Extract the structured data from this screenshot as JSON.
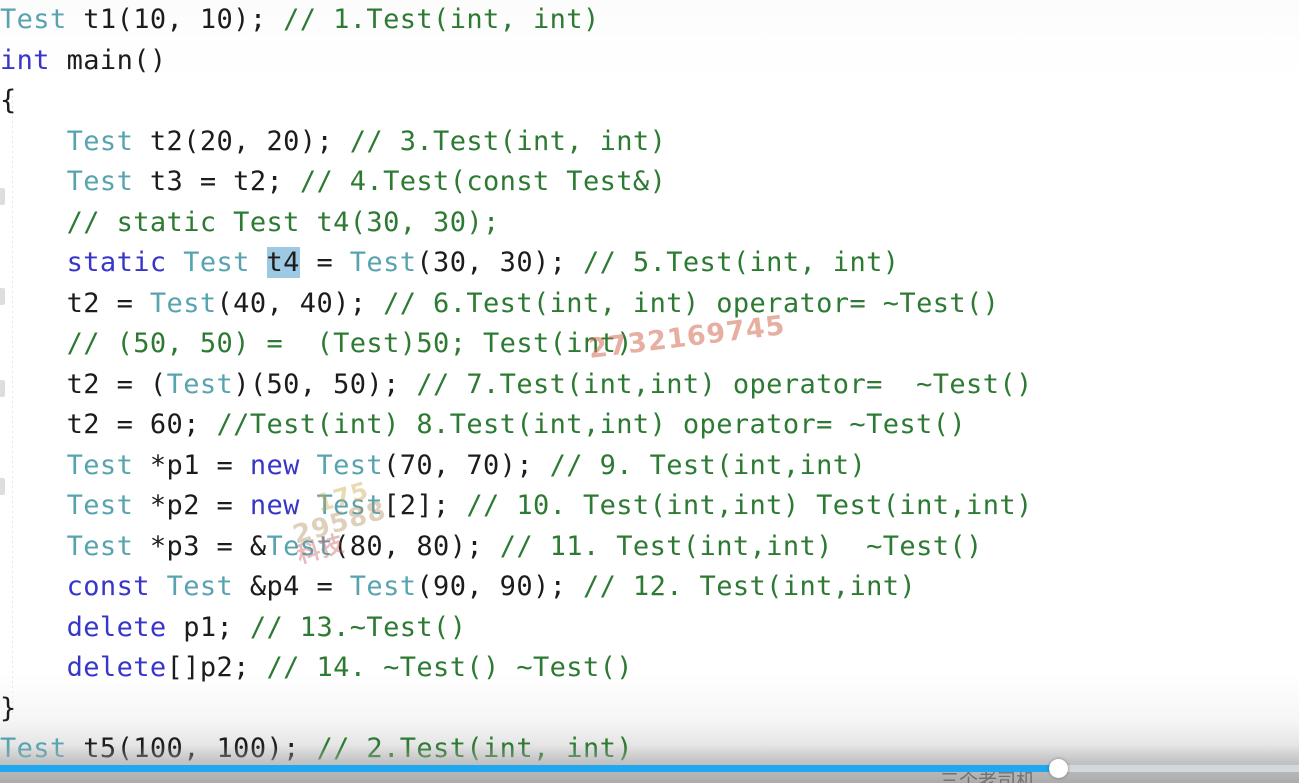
{
  "editor": {
    "language": "cpp",
    "selection_text": "t4",
    "colors": {
      "background": "#fdfdfd",
      "keyword": "#3736c9",
      "type": "#58a3b0",
      "comment": "#2d7a33",
      "plain": "#1c1c1c",
      "selection": "#9ec9e2",
      "indent_guide": "#e6e6e6"
    },
    "lines": [
      {
        "indent": 0,
        "tokens": [
          {
            "t": "Test",
            "c": "typ"
          },
          {
            "t": " t1(10, 10); ",
            "c": "pln"
          },
          {
            "t": "// 1.Test(int, int)",
            "c": "cmt"
          }
        ]
      },
      {
        "indent": 0,
        "tokens": [
          {
            "t": "int",
            "c": "kw"
          },
          {
            "t": " main()",
            "c": "pln"
          }
        ]
      },
      {
        "indent": 0,
        "tokens": [
          {
            "t": "{",
            "c": "pln"
          }
        ]
      },
      {
        "indent": 1,
        "tokens": [
          {
            "t": "Test",
            "c": "typ"
          },
          {
            "t": " t2(20, 20); ",
            "c": "pln"
          },
          {
            "t": "// 3.Test(int, int)",
            "c": "cmt"
          }
        ]
      },
      {
        "indent": 1,
        "tokens": [
          {
            "t": "Test",
            "c": "typ"
          },
          {
            "t": " t3 = t2; ",
            "c": "pln"
          },
          {
            "t": "// 4.Test(const Test&)",
            "c": "cmt"
          }
        ]
      },
      {
        "indent": 1,
        "tokens": [
          {
            "t": "// static Test t4(30, 30);",
            "c": "cmt"
          }
        ]
      },
      {
        "indent": 1,
        "tokens": [
          {
            "t": "static",
            "c": "kw"
          },
          {
            "t": " ",
            "c": "pln"
          },
          {
            "t": "Test",
            "c": "typ"
          },
          {
            "t": " ",
            "c": "pln"
          },
          {
            "t": "t4",
            "c": "pln sel"
          },
          {
            "t": " = ",
            "c": "pln"
          },
          {
            "t": "Test",
            "c": "typ"
          },
          {
            "t": "(30, 30); ",
            "c": "pln"
          },
          {
            "t": "// 5.Test(int, int)",
            "c": "cmt"
          }
        ]
      },
      {
        "indent": 1,
        "tokens": [
          {
            "t": "t2 = ",
            "c": "pln"
          },
          {
            "t": "Test",
            "c": "typ"
          },
          {
            "t": "(40, 40); ",
            "c": "pln"
          },
          {
            "t": "// 6.Test(int, int) operator= ~Test()",
            "c": "cmt"
          }
        ]
      },
      {
        "indent": 1,
        "tokens": [
          {
            "t": "// (50, 50) =  (Test)50; Test(int)",
            "c": "cmt"
          }
        ]
      },
      {
        "indent": 1,
        "tokens": [
          {
            "t": "t2 = (",
            "c": "pln"
          },
          {
            "t": "Test",
            "c": "typ"
          },
          {
            "t": ")(50, 50); ",
            "c": "pln"
          },
          {
            "t": "// 7.Test(int,int) operator=  ~Test()",
            "c": "cmt"
          }
        ]
      },
      {
        "indent": 1,
        "tokens": [
          {
            "t": "t2 = 60; ",
            "c": "pln"
          },
          {
            "t": "//Test(int) 8.Test(int,int) operator= ~Test()",
            "c": "cmt"
          }
        ]
      },
      {
        "indent": 1,
        "tokens": [
          {
            "t": "Test",
            "c": "typ"
          },
          {
            "t": " *p1 = ",
            "c": "pln"
          },
          {
            "t": "new",
            "c": "kw"
          },
          {
            "t": " ",
            "c": "pln"
          },
          {
            "t": "Test",
            "c": "typ"
          },
          {
            "t": "(70, 70); ",
            "c": "pln"
          },
          {
            "t": "// 9. Test(int,int)",
            "c": "cmt"
          }
        ]
      },
      {
        "indent": 1,
        "tokens": [
          {
            "t": "Test",
            "c": "typ"
          },
          {
            "t": " *p2 = ",
            "c": "pln"
          },
          {
            "t": "new",
            "c": "kw"
          },
          {
            "t": " ",
            "c": "pln"
          },
          {
            "t": "Test",
            "c": "typ"
          },
          {
            "t": "[2]; ",
            "c": "pln"
          },
          {
            "t": "// 10. Test(int,int) Test(int,int)",
            "c": "cmt"
          }
        ]
      },
      {
        "indent": 1,
        "tokens": [
          {
            "t": "Test",
            "c": "typ"
          },
          {
            "t": " *p3 = &",
            "c": "pln"
          },
          {
            "t": "Test",
            "c": "typ"
          },
          {
            "t": "(80, 80); ",
            "c": "pln"
          },
          {
            "t": "// 11. Test(int,int)  ~Test()",
            "c": "cmt"
          }
        ]
      },
      {
        "indent": 1,
        "tokens": [
          {
            "t": "const",
            "c": "kw"
          },
          {
            "t": " ",
            "c": "pln"
          },
          {
            "t": "Test",
            "c": "typ"
          },
          {
            "t": " &p4 = ",
            "c": "pln"
          },
          {
            "t": "Test",
            "c": "typ"
          },
          {
            "t": "(90, 90); ",
            "c": "pln"
          },
          {
            "t": "// 12. Test(int,int)",
            "c": "cmt"
          }
        ]
      },
      {
        "indent": 1,
        "tokens": [
          {
            "t": "delete",
            "c": "kw"
          },
          {
            "t": " p1; ",
            "c": "pln"
          },
          {
            "t": "// 13.~Test()",
            "c": "cmt"
          }
        ]
      },
      {
        "indent": 1,
        "tokens": [
          {
            "t": "delete",
            "c": "kw"
          },
          {
            "t": "[]p2; ",
            "c": "pln"
          },
          {
            "t": "// 14. ~Test() ~Test()",
            "c": "cmt"
          }
        ]
      },
      {
        "indent": 0,
        "tokens": [
          {
            "t": "}",
            "c": "pln"
          }
        ]
      },
      {
        "indent": 0,
        "tokens": [
          {
            "t": "Test",
            "c": "typ"
          },
          {
            "t": " t5(100, 100); ",
            "c": "pln"
          },
          {
            "t": "// 2.Test(int, int)",
            "c": "cmt"
          }
        ]
      }
    ]
  },
  "watermarks": [
    {
      "text": "2732169745",
      "color": "#d2664e"
    },
    {
      "text": "175",
      "color": "#c9a84e"
    },
    {
      "text": "29588",
      "color": "#b08c5a"
    },
    {
      "text": "科技",
      "color": "#c96a6a"
    }
  ],
  "player": {
    "progress_percent": 81.5,
    "accent_color": "#1fa8f0",
    "track_color": "#d2d8dc",
    "handle_color": "#ffffff",
    "caption": "三个老司机"
  }
}
